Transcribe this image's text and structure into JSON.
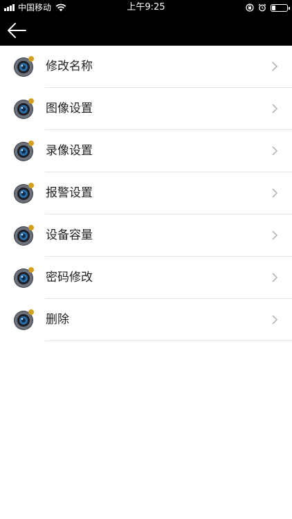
{
  "status_bar": {
    "carrier": "中国移动",
    "time": "上午9:25"
  },
  "nav": {
    "back_icon": "arrow-left-icon"
  },
  "menu": {
    "items": [
      {
        "label": "修改名称",
        "icon": "camera-icon"
      },
      {
        "label": "图像设置",
        "icon": "camera-icon"
      },
      {
        "label": "录像设置",
        "icon": "camera-icon"
      },
      {
        "label": "报警设置",
        "icon": "camera-icon"
      },
      {
        "label": "设备容量",
        "icon": "camera-icon"
      },
      {
        "label": "密码修改",
        "icon": "camera-icon"
      },
      {
        "label": "删除",
        "icon": "camera-icon"
      }
    ]
  },
  "colors": {
    "header_bg": "#000000",
    "background": "#ffffff",
    "text": "#222222",
    "divider": "#e3e3e3",
    "badge": "#d4a11e"
  }
}
